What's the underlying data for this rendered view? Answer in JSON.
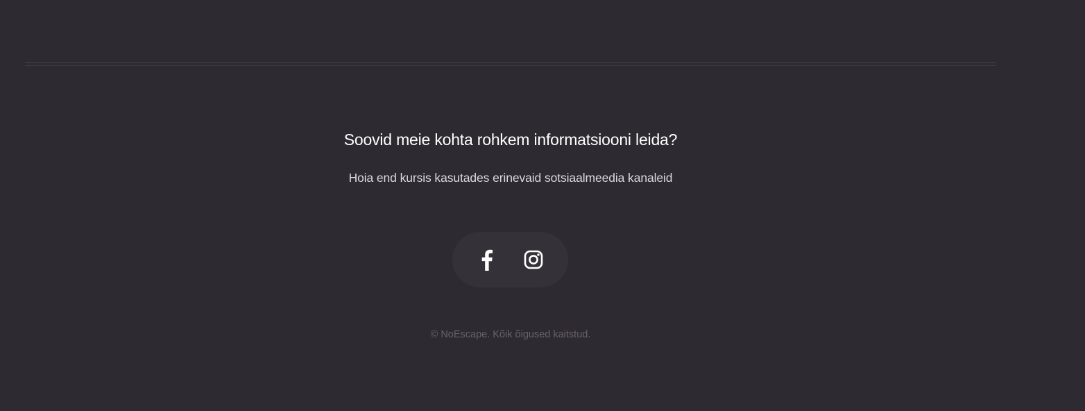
{
  "footer": {
    "headline": "Soovid meie kohta rohkem informatsiooni leida?",
    "subline": "Hoia end kursis kasutades erinevaid sotsiaalmeedia kanaleid",
    "social": [
      {
        "name": "Facebook",
        "icon": "facebook-icon"
      },
      {
        "name": "Instagram",
        "icon": "instagram-icon"
      }
    ],
    "copyright": "© NoEscape. Kõik õigused kaitstud."
  },
  "colors": {
    "background": "#2e2a31",
    "pill": "#353138",
    "text": "#ffffff",
    "muted": "#67626b"
  }
}
